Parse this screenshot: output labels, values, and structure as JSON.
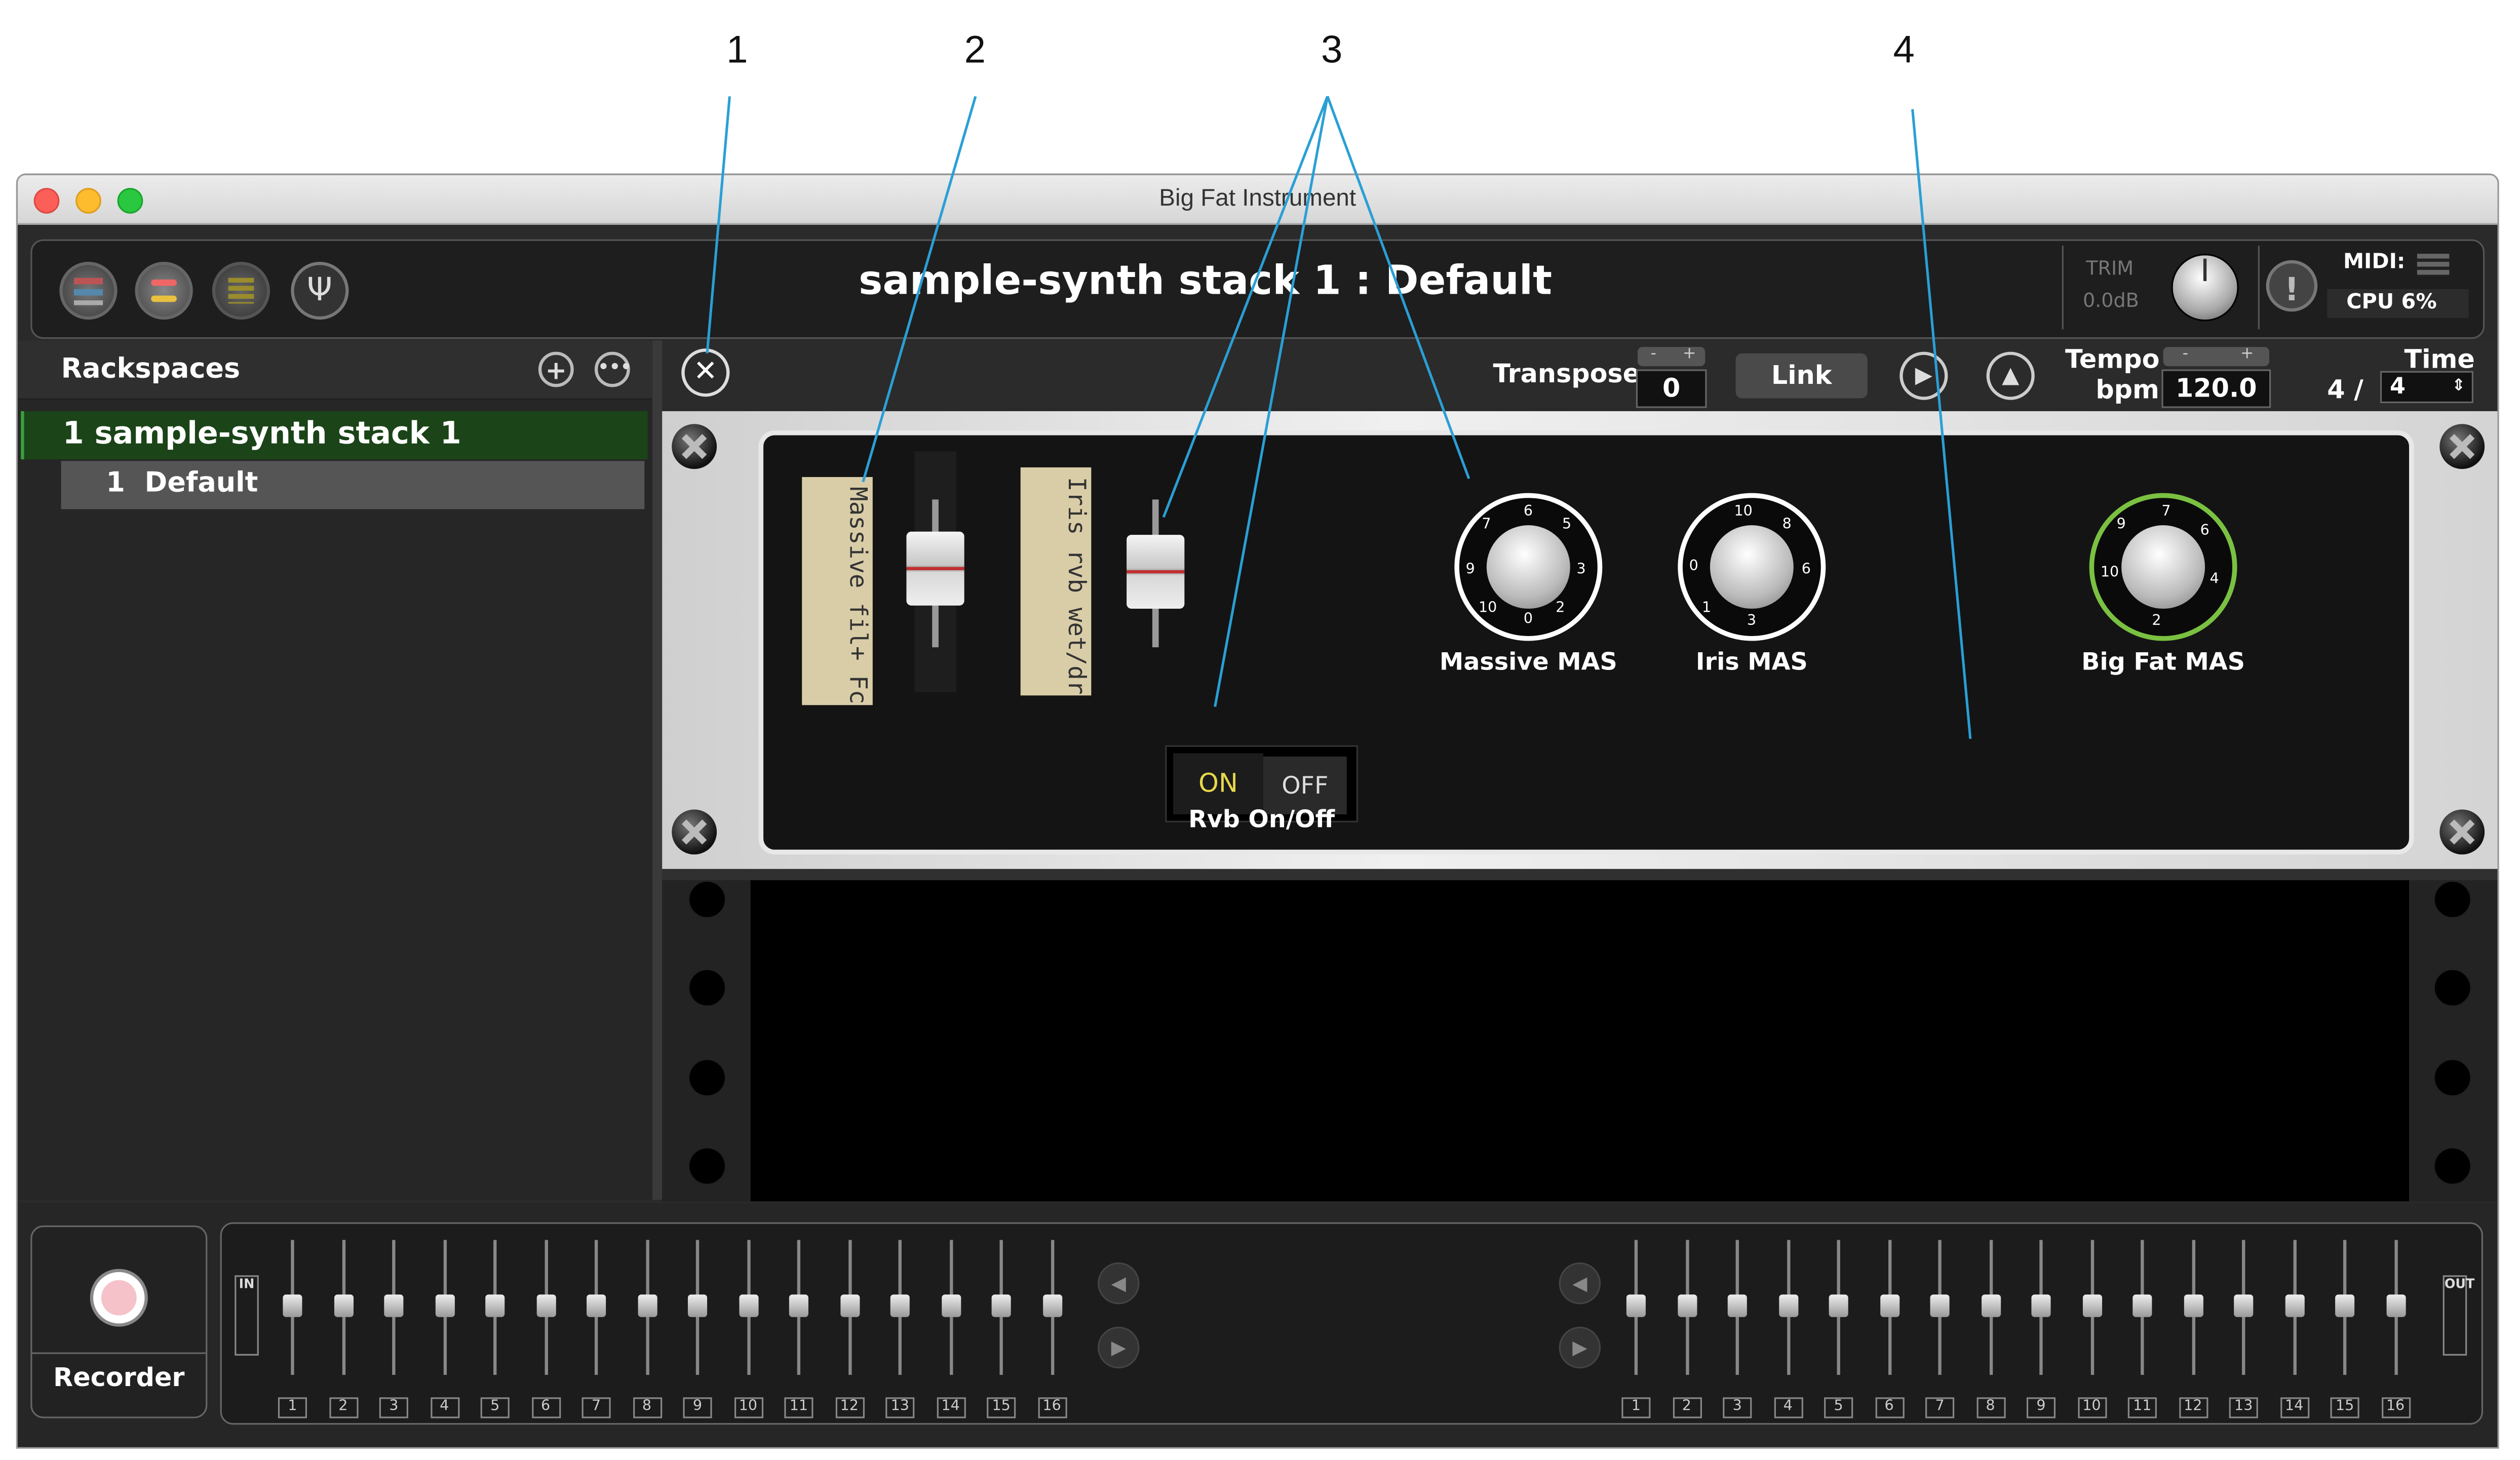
{
  "callouts": [
    "1",
    "2",
    "3",
    "4"
  ],
  "window": {
    "title": "Big Fat Instrument"
  },
  "header": {
    "stack_title": "sample-synth stack 1 : Default",
    "trim_label": "TRIM",
    "trim_value": "0.0dB",
    "midi_label": "MIDI:",
    "cpu_label": "CPU 6%",
    "icons": [
      "rack-view-icon",
      "setlist-icon",
      "panels-icon",
      "tuner-icon",
      "warning-icon"
    ]
  },
  "sidebar": {
    "title": "Rackspaces",
    "rackspace": "1 sample-synth stack 1",
    "variation_num": "1",
    "variation_name": "Default"
  },
  "toolbar": {
    "transpose_label": "Transpose",
    "transpose_value": "0",
    "link_label": "Link",
    "tempo_label": "Tempo",
    "bpm_label": "bpm",
    "tempo_value": "120.0",
    "time_label": "Time",
    "time_num": "4 /",
    "time_den": "4",
    "stepper_minus": "-",
    "stepper_plus": "+"
  },
  "rack": {
    "tape1": "Massive fil+ Fc",
    "tape2": "Iris rvb wet/dr",
    "switch_on": "ON",
    "switch_off": "OFF",
    "switch_label": "Rvb On/Off",
    "knobs": [
      "Massive MAS",
      "Iris MAS",
      "Big Fat MAS"
    ],
    "knob_scale": [
      "0",
      "1",
      "2",
      "3",
      "4",
      "5",
      "6",
      "7",
      "8",
      "9",
      "10"
    ]
  },
  "bottom": {
    "recorder_label": "Recorder",
    "in_label": "IN",
    "out_label": "OUT",
    "channels": [
      "1",
      "2",
      "3",
      "4",
      "5",
      "6",
      "7",
      "8",
      "9",
      "10",
      "11",
      "12",
      "13",
      "14",
      "15",
      "16"
    ]
  },
  "colors": {
    "accent_green": "#3aa03a",
    "callout_line": "#2a9fd6",
    "rack_selected": "#1b4418"
  }
}
